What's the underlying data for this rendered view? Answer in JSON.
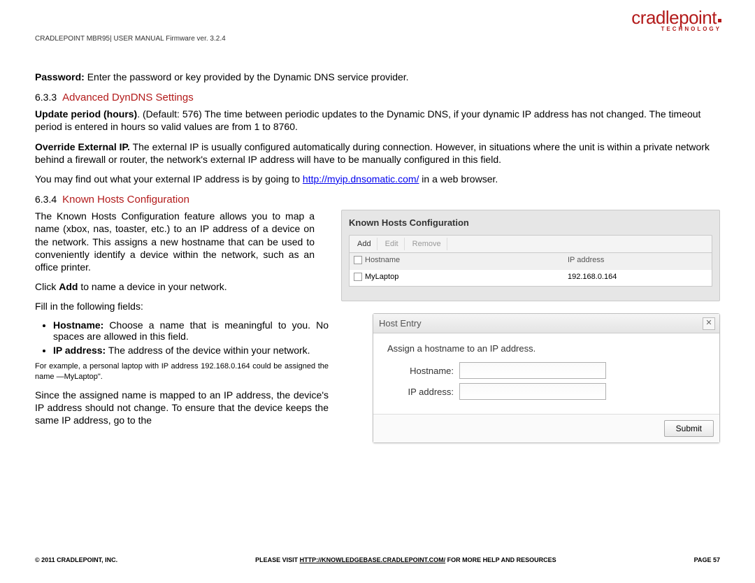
{
  "header": {
    "manual_line": "CRADLEPOINT MBR95| USER MANUAL Firmware ver. 3.2.4",
    "logo_main": "cradlepoint",
    "logo_sub": "TECHNOLOGY"
  },
  "body": {
    "password_label": "Password:",
    "password_text": " Enter the password or key provided by the Dynamic DNS service provider.",
    "s633_num": "6.3.3",
    "s633_title": "Advanced DynDNS Settings",
    "update_label": "Update period (hours)",
    "update_text": ". (Default: 576) The time between periodic updates to the Dynamic DNS, if your dynamic IP address has not changed. The timeout period is entered in hours so valid values are from 1 to 8760.",
    "override_label": "Override External IP.",
    "override_text": " The external IP is usually configured automatically during connection. However, in situations where the unit is within a private network behind a firewall or router, the network's external IP address will have to be manually configured in this field.",
    "findip_pre": "You may find out what your external IP address is by going to ",
    "findip_link": "http://myip.dnsomatic.com/",
    "findip_post": " in a web browser.",
    "s634_num": "6.3.4",
    "s634_title": "Known Hosts Configuration",
    "khc_para": "The Known Hosts Configuration feature allows you to map a name (xbox, nas, toaster, etc.) to an IP address of a device on the network. This assigns a new hostname that can be used to conveniently identify a device within the network, such as an office printer.",
    "click_add_pre": "Click ",
    "click_add_bold": "Add",
    "click_add_post": " to name a device in your network.",
    "fillin": "Fill in the following fields:",
    "b_host_label": "Hostname:",
    "b_host_text": " Choose a name that is meaningful to you. No spaces are allowed in this field.",
    "b_ip_label": "IP address:",
    "b_ip_text": " The address of the device within your network.",
    "example": "For example, a personal laptop with IP address 192.168.0.164 could be assigned the name ―MyLaptop\".",
    "since_para": "Since the assigned name is mapped to an IP address, the device's IP address should not change. To ensure that the device keeps the same IP address, go to the"
  },
  "khc_panel": {
    "title": "Known Hosts Configuration",
    "btn_add": "Add",
    "btn_edit": "Edit",
    "btn_remove": "Remove",
    "col_host": "Hostname",
    "col_ip": "IP address",
    "row_host": "MyLaptop",
    "row_ip": "192.168.0.164"
  },
  "he_panel": {
    "title": "Host Entry",
    "desc": "Assign a hostname to an IP address.",
    "label_host": "Hostname:",
    "label_ip": "IP address:",
    "submit": "Submit"
  },
  "footer": {
    "left": "© 2011 CRADLEPOINT, INC.",
    "mid_pre": "PLEASE VISIT ",
    "mid_link": "HTTP://KNOWLEDGEBASE.CRADLEPOINT.COM/",
    "mid_post": " FOR MORE HELP AND RESOURCES",
    "right": "PAGE 57"
  }
}
